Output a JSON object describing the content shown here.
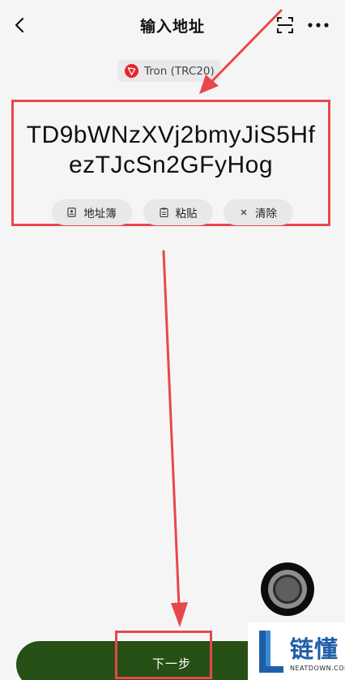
{
  "header": {
    "title": "输入地址",
    "back_icon": "chevron-left-icon",
    "scan_icon": "scan-icon",
    "more_icon": "more-icon"
  },
  "network": {
    "label": "Tron (TRC20)",
    "icon": "tron-icon",
    "icon_color": "#e5252a"
  },
  "address": {
    "line1": "TD9bWNzXVj2bmyJiS5Hf",
    "line2": "ezTJcSn2GFyHog"
  },
  "actions": {
    "address_book": "地址簿",
    "paste": "粘贴",
    "clear": "清除"
  },
  "next_button": {
    "label": "下一步",
    "color": "#265016"
  },
  "annotation_color": "#e8484b",
  "watermark": {
    "name": "链懂",
    "url": "NEATDOWN.COM"
  }
}
